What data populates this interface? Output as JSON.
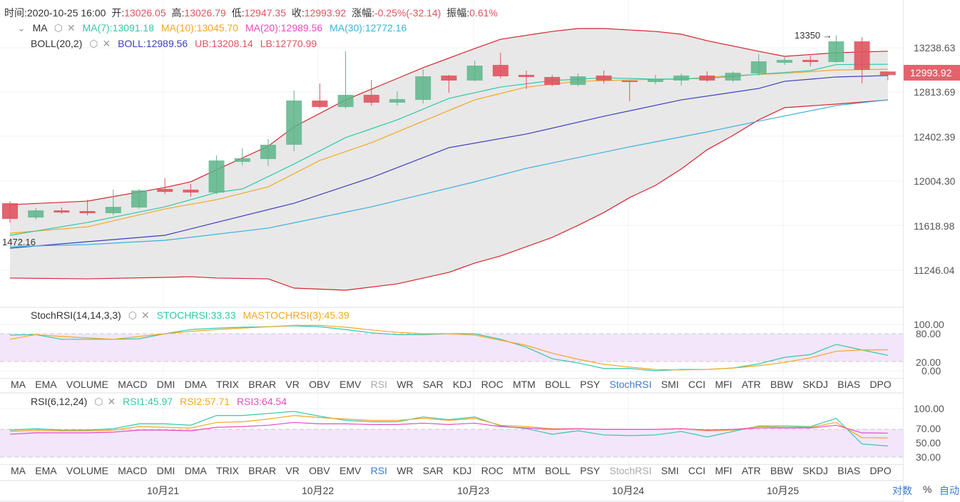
{
  "header": {
    "time_label": "时间:",
    "time": "2020-10-25 16:00",
    "open_label": "开:",
    "open": "13026.05",
    "high_label": "高:",
    "high": "13026.79",
    "low_label": "低:",
    "low": "12947.35",
    "close_label": "收:",
    "close": "12993.92",
    "change_label": "涨幅:",
    "change": "-0.25%(-32.14)",
    "amp_label": "振幅:",
    "amp": "0.61%"
  },
  "ma_legend": {
    "name": "MA",
    "ma7": "MA(7):13091.18",
    "ma10": "MA(10):13045.70",
    "ma20": "MA(20):12989.56",
    "ma30": "MA(30):12772.16"
  },
  "boll_legend": {
    "name": "BOLL(20,2)",
    "boll": "BOLL:12989.56",
    "ub": "UB:13208.14",
    "lb": "LB:12770.99"
  },
  "stoch_legend": {
    "name": "StochRSI(14,14,3,3)",
    "stoch": "STOCHRSI:33.33",
    "ma": "MASTOCHRSI(3):45.39"
  },
  "rsi_legend": {
    "name": "RSI(6,12,24)",
    "rsi1": "RSI1:45.97",
    "rsi2": "RSI2:57.71",
    "rsi3": "RSI3:64.54"
  },
  "annotations": {
    "max": "13350 →",
    "min": "1472.16",
    "last_price": "12993.92"
  },
  "indicator_tabs": [
    "MA",
    "EMA",
    "VOLUME",
    "MACD",
    "DMI",
    "DMA",
    "TRIX",
    "BRAR",
    "VR",
    "OBV",
    "EMV",
    "RSI",
    "WR",
    "SAR",
    "KDJ",
    "ROC",
    "MTM",
    "BOLL",
    "PSY",
    "StochRSI",
    "SMI",
    "CCI",
    "MFI",
    "ATR",
    "BBW",
    "SKDJ",
    "BIAS",
    "DPO"
  ],
  "bottom_controls": {
    "log": "对数",
    "percent": "%",
    "auto": "自动"
  },
  "colors": {
    "up": "#5cb58a",
    "down": "#e0535e",
    "ma7": "#30c9a8",
    "ma10": "#f5a623",
    "ma20": "#e84ac0",
    "ma30": "#3cb0e0",
    "boll": "#3a3fbf",
    "band": "#d9232e"
  },
  "chart_data": [
    {
      "type": "candlestick",
      "title": "Price",
      "x": "4h candles, 10月20 20:00 – 10月25 16:00",
      "x_ticks": [
        "10月21",
        "10月22",
        "10月23",
        "10月24",
        "10月25"
      ],
      "y_ticks": [
        "13238.63",
        "12813.69",
        "12402.39",
        "12004.30",
        "11618.98",
        "11246.04"
      ],
      "ohlc": [
        [
          11846,
          11865,
          11674,
          11706
        ],
        [
          11718,
          11802,
          11699,
          11782
        ],
        [
          11782,
          11808,
          11750,
          11763
        ],
        [
          11776,
          11878,
          11738,
          11757
        ],
        [
          11757,
          11968,
          11738,
          11814
        ],
        [
          11808,
          11974,
          11795,
          11961
        ],
        [
          11974,
          12070,
          11929,
          11948
        ],
        [
          11968,
          12019,
          11904,
          11942
        ],
        [
          11942,
          12274,
          11929,
          12229
        ],
        [
          12217,
          12338,
          12185,
          12249
        ],
        [
          12242,
          12421,
          12178,
          12370
        ],
        [
          12370,
          12855,
          12313,
          12766
        ],
        [
          12766,
          12919,
          12696,
          12708
        ],
        [
          12708,
          13207,
          12696,
          12817
        ],
        [
          12817,
          12951,
          12721,
          12747
        ],
        [
          12747,
          12849,
          12721,
          12779
        ],
        [
          12772,
          13047,
          12740,
          12983
        ],
        [
          12990,
          12996,
          12836,
          12945
        ],
        [
          12945,
          13124,
          12938,
          13079
        ],
        [
          13085,
          13194,
          12964,
          12983
        ],
        [
          12996,
          13034,
          12868,
          12977
        ],
        [
          12977,
          12996,
          12894,
          12906
        ],
        [
          12906,
          13009,
          12894,
          12983
        ],
        [
          12990,
          13034,
          12919,
          12945
        ],
        [
          12945,
          12945,
          12760,
          12932
        ],
        [
          12932,
          12996,
          12913,
          12958
        ],
        [
          12945,
          13009,
          12900,
          12990
        ],
        [
          12990,
          13028,
          12932,
          12945
        ],
        [
          12945,
          13028,
          12932,
          13015
        ],
        [
          13009,
          13181,
          12990,
          13117
        ],
        [
          13104,
          13162,
          13085,
          13130
        ],
        [
          13130,
          13168,
          13073,
          13111
        ],
        [
          13111,
          13350,
          13104,
          13296
        ],
        [
          13296,
          13334,
          12919,
          13041
        ],
        [
          13026.05,
          13026.79,
          12947.35,
          12993.92
        ]
      ],
      "series": [
        {
          "name": "UB",
          "color": "band",
          "points": [
            [
              0,
              11833
            ],
            [
              3,
              11865
            ],
            [
              6,
              11987
            ],
            [
              7,
              12038
            ],
            [
              8,
              12146
            ],
            [
              10,
              12357
            ],
            [
              11,
              12530
            ],
            [
              13,
              12772
            ],
            [
              15,
              12964
            ],
            [
              16,
              13060
            ],
            [
              18,
              13232
            ],
            [
              19,
              13315
            ],
            [
              21,
              13385
            ],
            [
              22,
              13411
            ],
            [
              23,
              13411
            ],
            [
              25,
              13385
            ],
            [
              26,
              13360
            ],
            [
              27,
              13302
            ],
            [
              29,
              13207
            ],
            [
              30,
              13162
            ],
            [
              32,
              13194
            ],
            [
              34,
              13208
            ]
          ]
        },
        {
          "name": "LB",
          "color": "band",
          "points": [
            [
              0,
              11176
            ],
            [
              3,
              11169
            ],
            [
              6,
              11182
            ],
            [
              7,
              11188
            ],
            [
              8,
              11176
            ],
            [
              10,
              11169
            ],
            [
              11,
              11086
            ],
            [
              13,
              11067
            ],
            [
              15,
              11124
            ],
            [
              17,
              11227
            ],
            [
              18,
              11310
            ],
            [
              19,
              11374
            ],
            [
              21,
              11540
            ],
            [
              22,
              11648
            ],
            [
              23,
              11763
            ],
            [
              24,
              11897
            ],
            [
              25,
              12006
            ],
            [
              26,
              12153
            ],
            [
              27,
              12325
            ],
            [
              28,
              12453
            ],
            [
              29,
              12593
            ],
            [
              30,
              12702
            ],
            [
              32,
              12734
            ],
            [
              34,
              12771
            ]
          ]
        },
        {
          "name": "BOLL",
          "color": "boll",
          "points": [
            [
              0,
              11444
            ],
            [
              6,
              11559
            ],
            [
              8,
              11674
            ],
            [
              11,
              11846
            ],
            [
              14,
              12076
            ],
            [
              17,
              12344
            ],
            [
              20,
              12466
            ],
            [
              23,
              12625
            ],
            [
              26,
              12772
            ],
            [
              29,
              12874
            ],
            [
              30,
              12938
            ],
            [
              32,
              12977
            ],
            [
              34,
              12990
            ]
          ]
        },
        {
          "name": "MA30",
          "color": "ma30",
          "points": [
            [
              0,
              11457
            ],
            [
              3,
              11476
            ],
            [
              6,
              11514
            ],
            [
              10,
              11623
            ],
            [
              14,
              11814
            ],
            [
              18,
              12038
            ],
            [
              20,
              12159
            ],
            [
              24,
              12351
            ],
            [
              27,
              12485
            ],
            [
              29,
              12581
            ],
            [
              32,
              12721
            ],
            [
              34,
              12772
            ]
          ]
        },
        {
          "name": "MA10",
          "color": "ma10",
          "points": [
            [
              0,
              11578
            ],
            [
              3,
              11635
            ],
            [
              6,
              11795
            ],
            [
              8,
              11878
            ],
            [
              10,
              11993
            ],
            [
              12,
              12229
            ],
            [
              14,
              12389
            ],
            [
              16,
              12581
            ],
            [
              18,
              12772
            ],
            [
              20,
              12887
            ],
            [
              22,
              12938
            ],
            [
              24,
              12951
            ],
            [
              26,
              12958
            ],
            [
              28,
              12990
            ],
            [
              30,
              13009
            ],
            [
              32,
              13040
            ],
            [
              34,
              13046
            ]
          ]
        },
        {
          "name": "MA7",
          "color": "ma7",
          "points": [
            [
              0,
              11559
            ],
            [
              3,
              11674
            ],
            [
              6,
              11814
            ],
            [
              8,
              11942
            ],
            [
              9,
              11974
            ],
            [
              11,
              12197
            ],
            [
              13,
              12434
            ],
            [
              15,
              12593
            ],
            [
              17,
              12785
            ],
            [
              19,
              12887
            ],
            [
              21,
              12945
            ],
            [
              23,
              12970
            ],
            [
              25,
              12958
            ],
            [
              27,
              12964
            ],
            [
              29,
              13002
            ],
            [
              31,
              13034
            ],
            [
              32,
              13088
            ],
            [
              34,
              13091
            ]
          ]
        }
      ]
    },
    {
      "type": "line",
      "title": "StochRSI(14,14,3,3)",
      "y_ticks": [
        "100.00",
        "80.00",
        "20.00",
        "0.00"
      ],
      "ylim": [
        0,
        100
      ],
      "band": [
        20,
        80
      ],
      "series": [
        {
          "name": "STOCHRSI",
          "color": "ma7",
          "values": [
            77,
            78,
            68,
            68,
            68,
            69,
            80,
            89,
            92,
            94,
            95,
            97,
            95,
            89,
            82,
            78,
            78,
            80,
            80,
            68,
            51,
            26,
            17,
            5,
            5,
            0,
            3,
            3,
            6,
            15,
            29,
            35,
            57,
            45,
            33.33
          ]
        },
        {
          "name": "MASTOCHRSI",
          "color": "ma10",
          "values": [
            68,
            78,
            74,
            71,
            68,
            74,
            80,
            85,
            89,
            92,
            95,
            98,
            98,
            94,
            88,
            83,
            80,
            80,
            77,
            66,
            55,
            38,
            25,
            14,
            8,
            3,
            2,
            3,
            6,
            11,
            18,
            28,
            42,
            45,
            45.39
          ]
        }
      ]
    },
    {
      "type": "line",
      "title": "RSI(6,12,24)",
      "y_ticks": [
        "100.00",
        "70.00",
        "50.00",
        "30.00"
      ],
      "ylim": [
        30,
        100
      ],
      "band": [
        30,
        70
      ],
      "series": [
        {
          "name": "RSI1",
          "color": "ma7",
          "values": [
            69,
            71,
            69,
            69,
            71,
            78,
            78,
            76,
            90,
            90,
            93,
            96,
            89,
            83,
            81,
            81,
            88,
            84,
            88,
            75,
            71,
            63,
            68,
            62,
            61,
            62,
            67,
            59,
            67,
            75,
            75,
            74,
            86,
            49,
            45.97
          ]
        },
        {
          "name": "RSI2",
          "color": "ma10",
          "values": [
            67,
            69,
            68,
            68,
            69,
            74,
            73,
            72,
            80,
            81,
            85,
            90,
            87,
            85,
            83,
            83,
            86,
            83,
            86,
            76,
            74,
            71,
            71,
            70,
            70,
            70,
            71,
            68,
            69,
            74,
            73,
            73,
            80,
            58,
            57.71
          ]
        },
        {
          "name": "RSI3",
          "color": "ma20",
          "values": [
            63,
            65,
            65,
            65,
            66,
            69,
            69,
            68,
            73,
            74,
            76,
            80,
            78,
            78,
            77,
            77,
            79,
            77,
            79,
            74,
            72,
            70,
            71,
            70,
            70,
            70,
            71,
            69,
            70,
            72,
            72,
            72,
            76,
            65,
            64.54
          ]
        }
      ]
    }
  ]
}
